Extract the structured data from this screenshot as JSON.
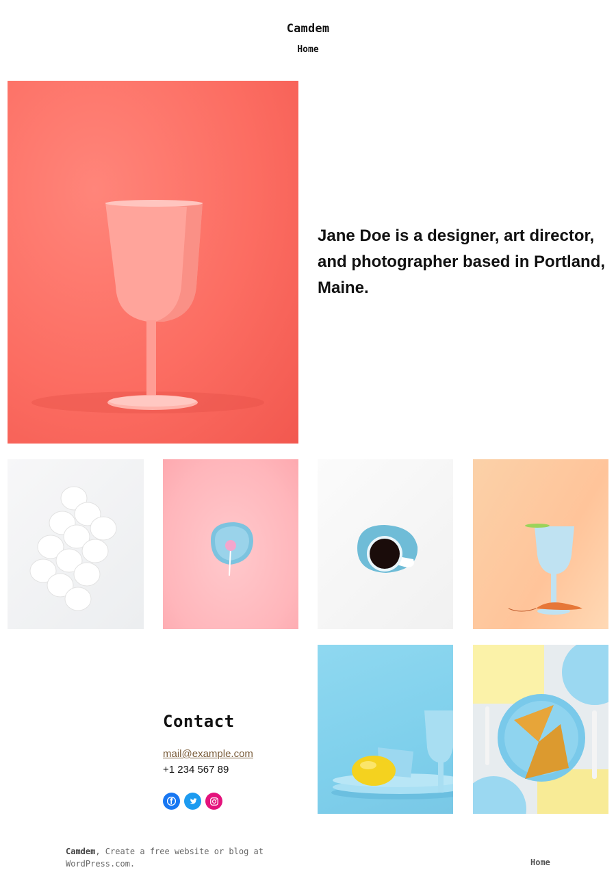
{
  "site": {
    "title": "Camdem"
  },
  "nav": {
    "home": "Home"
  },
  "bio": {
    "text": "Jane Doe is a designer, art director, and photographer based in Portland, Maine."
  },
  "gallery": {
    "hero": "pink-wine-glass-photo",
    "items": [
      "eggs-photo",
      "pink-plate-lollipop-photo",
      "blue-coffee-cup-photo",
      "orange-glass-shrimp-photo",
      "blue-lemon-glass-photo",
      "waffles-blue-plate-photo"
    ]
  },
  "contact": {
    "title": "Contact",
    "email": "mail@example.com",
    "phone": "+1 234 567 89"
  },
  "social": [
    {
      "name": "facebook-icon",
      "color": "#1877f2"
    },
    {
      "name": "twitter-icon",
      "color": "#1d9bf0"
    },
    {
      "name": "instagram-icon",
      "color": "#e4137c"
    }
  ],
  "footer": {
    "site": "Camdem",
    "tagline": ", Create a free website or blog at WordPress.com.",
    "home": "Home"
  }
}
